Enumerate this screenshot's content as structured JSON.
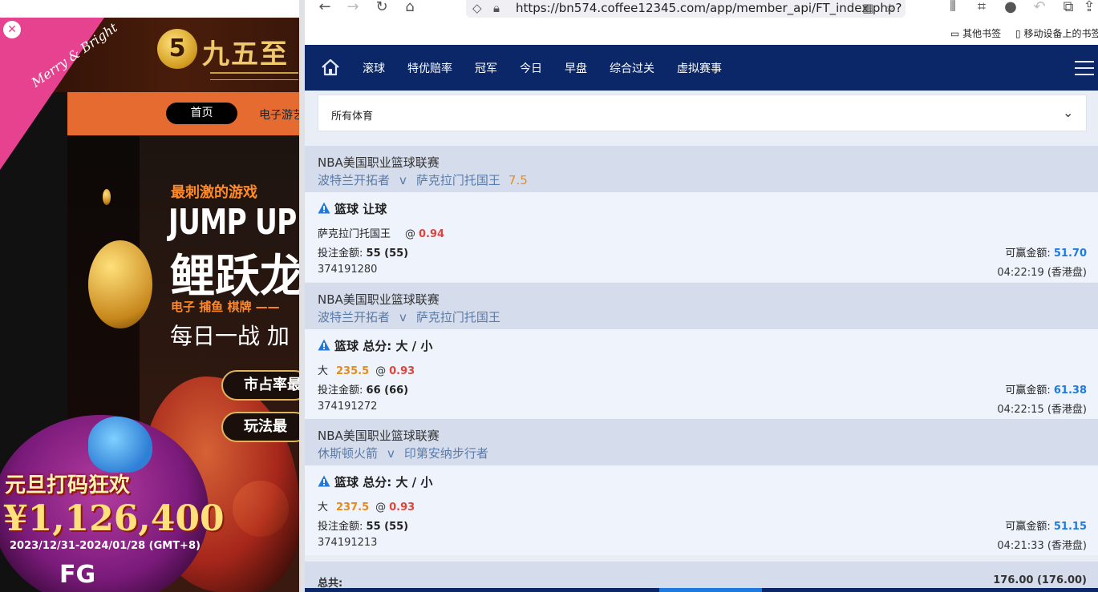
{
  "left_site": {
    "logo_glyph": "5",
    "logo_text": "九五至",
    "nav": {
      "home": "首页",
      "electronic": "电子游艺"
    },
    "merry": "Merry & Bright",
    "tagline": "最刺激的游戏",
    "headline_en": "JUMP UP",
    "headline_cn": "鲤跃龙",
    "categories": "电子  捕鱼  棋牌  ——",
    "daily": "每日一战  加",
    "pill_1": "市占率最",
    "pill_2": "玩法最",
    "promo_title": "元旦打码狂欢",
    "promo_amount": "¥1,126,400",
    "promo_dates": "2023/12/31-2024/01/28 (GMT+8)",
    "brand": "FG"
  },
  "browser": {
    "url": "https://bn574.coffee12345.com/app/member_api/FT_index.php?",
    "bookmarks": {
      "other": "其他书签",
      "mobile": "移动设备上的书签"
    },
    "icons": {
      "back": "back-arrow-icon",
      "forward": "forward-arrow-icon",
      "reload": "reload-icon",
      "home": "home-icon",
      "shield": "shield-icon",
      "lock": "lock-icon",
      "qr": "qr-code-icon",
      "star": "star-icon"
    }
  },
  "sitenav": {
    "tabs": [
      "滚球",
      "特优赔率",
      "冠军",
      "今日",
      "早盘",
      "综合过关",
      "虚拟赛事"
    ]
  },
  "filter": {
    "label": "所有体育"
  },
  "slips": [
    {
      "league": "NBA美国职业篮球联赛",
      "home": "波特兰开拓者",
      "vs": "v",
      "away": "萨克拉门托国王",
      "handicap": "7.5",
      "bet_title": "篮球 让球",
      "selection": "萨克拉门托国王",
      "line": "",
      "odds": "0.94",
      "stake_label": "投注金额:",
      "stake": "55 (55)",
      "win_label": "可赢金额:",
      "win": "51.70",
      "ticket": "374191280",
      "time": "04:22:19 (香港盘)"
    },
    {
      "league": "NBA美国职业篮球联赛",
      "home": "波特兰开拓者",
      "vs": "v",
      "away": "萨克拉门托国王",
      "handicap": "",
      "bet_title": "篮球 总分: 大 / 小",
      "selection": "大",
      "line": "235.5",
      "odds": "0.93",
      "stake_label": "投注金额:",
      "stake": "66 (66)",
      "win_label": "可赢金额:",
      "win": "61.38",
      "ticket": "374191272",
      "time": "04:22:15 (香港盘)"
    },
    {
      "league": "NBA美国职业篮球联赛",
      "home": "休斯顿火箭",
      "vs": "v",
      "away": "印第安纳步行者",
      "handicap": "",
      "bet_title": "篮球 总分: 大 / 小",
      "selection": "大",
      "line": "237.5",
      "odds": "0.93",
      "stake_label": "投注金额:",
      "stake": "55 (55)",
      "win_label": "可赢金额:",
      "win": "51.15",
      "ticket": "374191213",
      "time": "04:21:33 (香港盘)"
    }
  ],
  "total": {
    "label": "总共:",
    "value": "176.00 (176.00)"
  },
  "colors": {
    "navy": "#0b2767",
    "odds_red": "#e0443a",
    "line_orange": "#e88a1a",
    "win_blue": "#1f7ae0"
  }
}
